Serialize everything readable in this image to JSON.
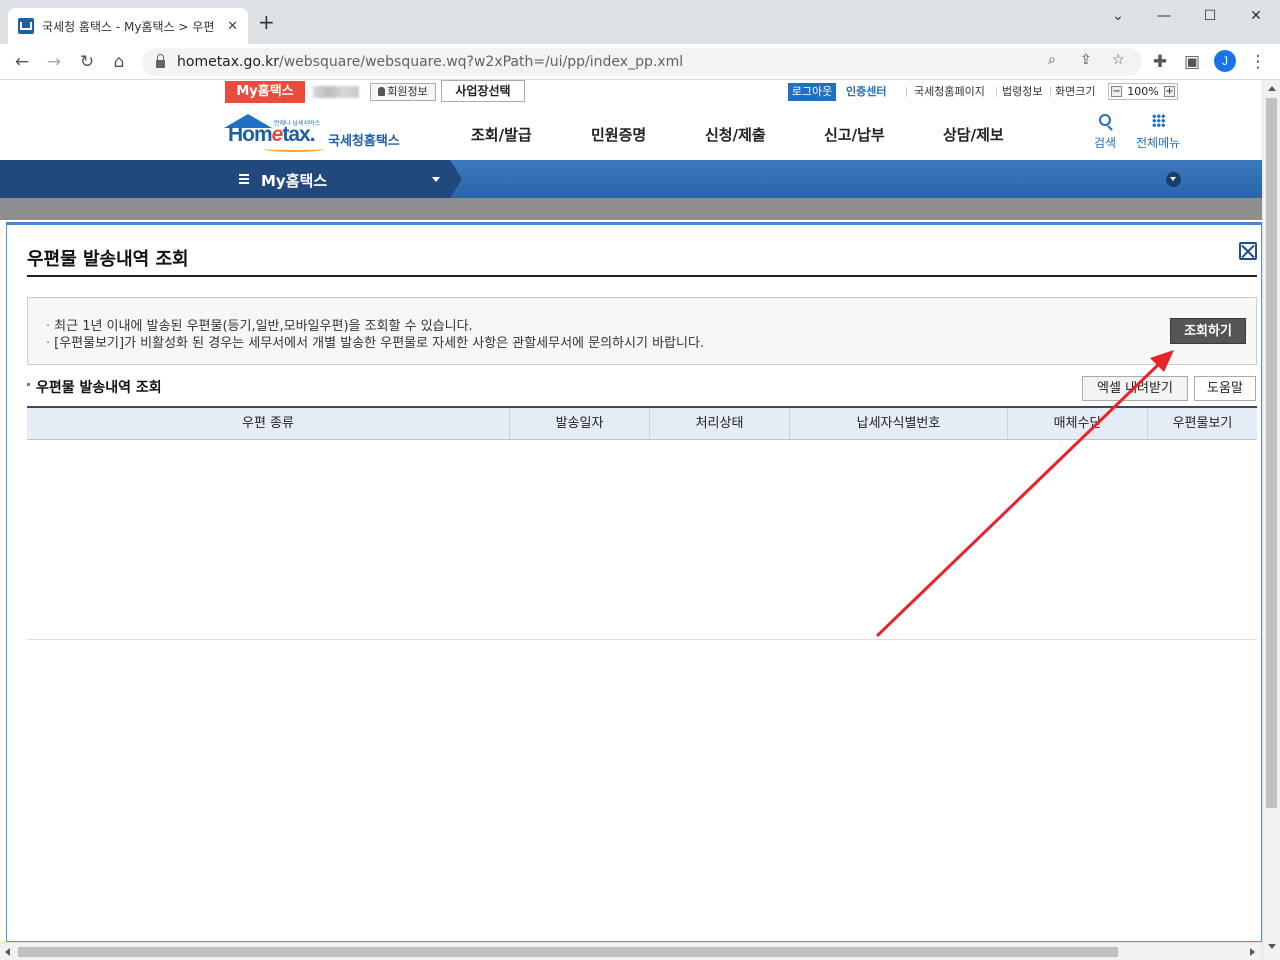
{
  "browser": {
    "tab_title": "국세청 홈택스 - My홈택스 > 우편",
    "tab_close": "✕",
    "new_tab": "+",
    "url_host": "hometax.go.kr",
    "url_path": "/websquare/websquare.wq?w2xPath=/ui/pp/index_pp.xml",
    "profile_initial": "J"
  },
  "util": {
    "my_hometax": "My홈택스",
    "member_info": "회원정보",
    "business_select": "사업장선택",
    "logout": "로그아웃",
    "cert_center": "인증센터",
    "nts_page": "국세청홈페이지",
    "law_info": "법령정보",
    "screen_size": "화면크기",
    "zoom_minus": "−",
    "zoom_value": "100%",
    "zoom_plus": "+"
  },
  "header": {
    "logo_tagline": "언제나 납세서비스",
    "logo_text_a": "Hom",
    "logo_text_e": "e",
    "logo_text_b": "tax.",
    "logo_kr": "국세청홈택스",
    "menu": [
      "조회/발급",
      "민원증명",
      "신청/제출",
      "신고/납부",
      "상담/제보"
    ],
    "search": "검색",
    "all_menu": "전체메뉴"
  },
  "navbar": {
    "title": "My홈택스"
  },
  "popup": {
    "title": "우편물 발송내역 조회",
    "notice_1": "최근 1년 이내에 발송된 우편물(등기,일반,모바일우편)을 조회할 수 있습니다.",
    "notice_2": "[우편물보기]가 비활성화 된 경우는 세무서에서 개별 발송한 우편물로 자세한 사항은 관할세무서에 문의하시기 바랍니다.",
    "query_button": "조회하기",
    "section_title": "우편물 발송내역 조회",
    "excel_button": "엑셀 내려받기",
    "help_button": "도움말",
    "columns": [
      "우편 종류",
      "발송일자",
      "처리상태",
      "납세자식별번호",
      "매체수단",
      "우편물보기"
    ]
  },
  "colors": {
    "accent_red": "#e94b3c",
    "brand_blue": "#1f6fc5",
    "nav_dark": "#21497e",
    "annotation_arrow": "#e8232b"
  }
}
